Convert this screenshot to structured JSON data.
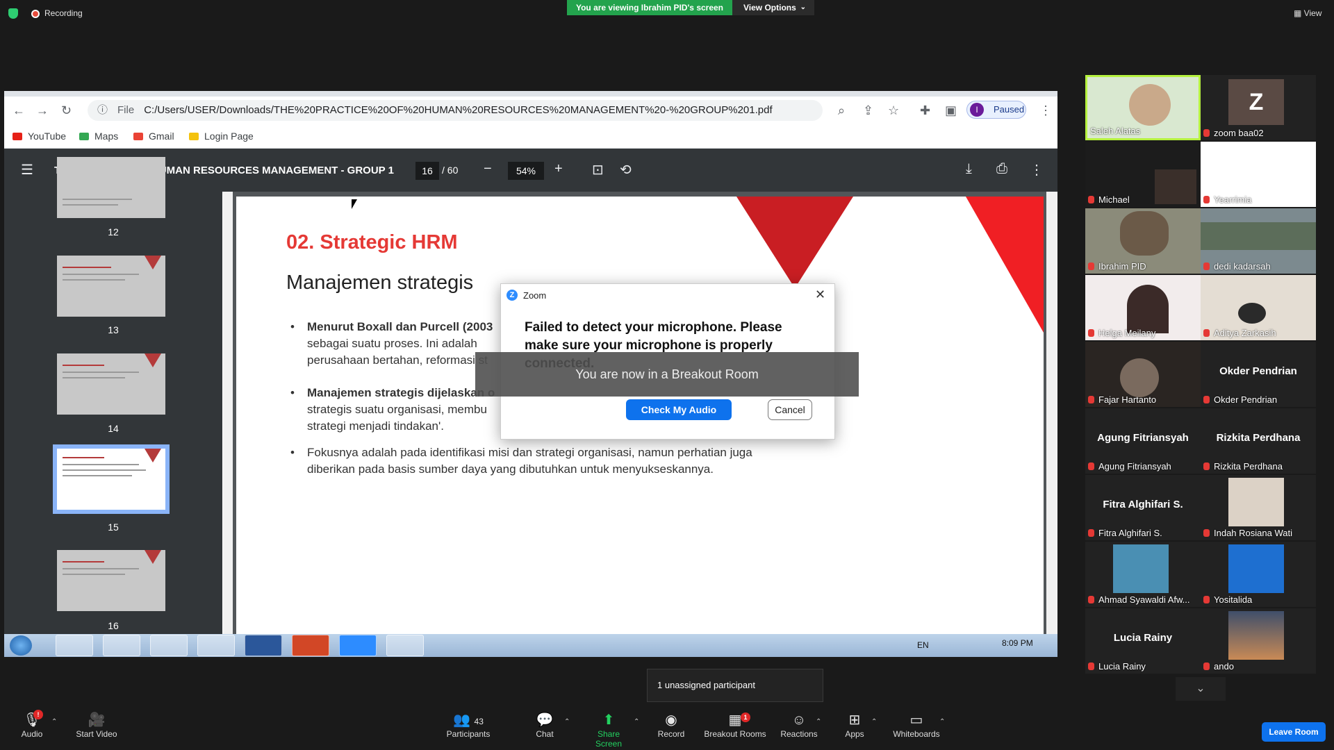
{
  "topbar": {
    "recording_label": "Recording",
    "viewing_banner": "You are viewing Ibrahim PID's screen",
    "view_options_label": "View Options",
    "view_label": "View"
  },
  "browser": {
    "file_label": "File",
    "url": "C:/Users/USER/Downloads/THE%20PRACTICE%20OF%20HUMAN%20RESOURCES%20MANAGEMENT%20-%20GROUP%201.pdf",
    "profile_initial": "I",
    "profile_status": "Paused",
    "bookmarks": [
      "YouTube",
      "Maps",
      "Gmail",
      "Login Page"
    ]
  },
  "pdf": {
    "title": "THE PRACTICE OF HUMAN RESOURCES MANAGEMENT - GROUP 1",
    "current_page": "16",
    "total_pages": "/ 60",
    "zoom": "54%",
    "thumbnails": [
      "12",
      "13",
      "14",
      "15",
      "16"
    ]
  },
  "slide": {
    "title": "02. Strategic HRM",
    "subtitle": "Manajemen strategis",
    "bullet1_bold": "Menurut Boxall dan Purcell (2003",
    "bullet1_line2": "sebagai suatu proses. Ini adalah",
    "bullet1_line3": "perusahaan bertahan, reformasi st",
    "bullet2_bold": "Manajemen strategis dijelaskan o",
    "bullet2_line2": "strategis suatu organisasi, membu",
    "bullet2_line3": "strategi menjadi tindakan'.",
    "bullet3_line1": "Fokusnya adalah pada identifikasi misi dan strategi organisasi, namun perhatian juga",
    "bullet3_line2": "diberikan pada basis sumber daya yang dibutuhkan untuk menyukseskannya."
  },
  "taskbar": {
    "language": "EN",
    "time": "8:09 PM"
  },
  "dialog": {
    "app_name": "Zoom",
    "message": "Failed to detect your microphone. Please make sure your microphone is properly connected.",
    "check_button": "Check My Audio Devices",
    "cancel_button": "Cancel"
  },
  "toast": "You are now in a Breakout Room",
  "participants": [
    {
      "name": "Saleh Alatas",
      "kind": "video"
    },
    {
      "name": "zoom baa02",
      "kind": "letter",
      "letter": "Z"
    },
    {
      "name": "Michael",
      "kind": "video"
    },
    {
      "name": "Yearrimia",
      "kind": "white"
    },
    {
      "name": "Ibrahim PID",
      "kind": "video"
    },
    {
      "name": "dedi kadarsah",
      "kind": "video"
    },
    {
      "name": "Helga Meilany",
      "kind": "video"
    },
    {
      "name": "Aditya Zarkasih",
      "kind": "video"
    },
    {
      "name": "Fajar Hartanto",
      "kind": "video"
    },
    {
      "name": "Okder Pendrian",
      "kind": "name"
    },
    {
      "name": "Agung Fitriansyah",
      "kind": "name"
    },
    {
      "name": "Rizkita Perdhana",
      "kind": "name"
    },
    {
      "name": "Fitra Alghifari S.",
      "kind": "name"
    },
    {
      "name": "Indah Rosiana Wati",
      "kind": "photo"
    },
    {
      "name": "Ahmad Syawaldi Afw...",
      "kind": "photo"
    },
    {
      "name": "Yositalida",
      "kind": "photo"
    },
    {
      "name": "Lucia Rainy",
      "kind": "name"
    },
    {
      "name": "ando",
      "kind": "photo"
    }
  ],
  "unassigned_notice": "1 unassigned participant",
  "toolbar": {
    "audio": "Audio",
    "start_video": "Start Video",
    "participants": "Participants",
    "participants_count": "43",
    "chat": "Chat",
    "share_screen": "Share Screen",
    "record": "Record",
    "breakout_rooms": "Breakout Rooms",
    "breakout_badge": "1",
    "reactions": "Reactions",
    "apps": "Apps",
    "whiteboards": "Whiteboards",
    "leave_room": "Leave Room",
    "audio_badge": "!"
  },
  "colors": {
    "zoom_blue": "#0e72ed",
    "share_green": "#23a34d",
    "slide_red": "#e53935"
  }
}
